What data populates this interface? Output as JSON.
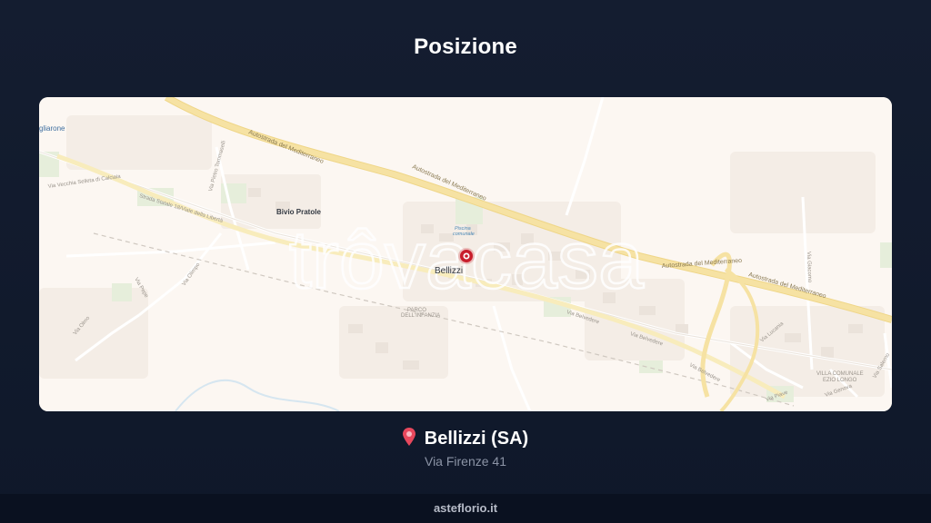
{
  "page": {
    "title": "Posizione"
  },
  "map": {
    "watermark": "trôvacasa",
    "marker_icon": "location-marker",
    "labels": {
      "autostrada_1": "Autostrada del Mediterraneo",
      "autostrada_2": "Autostrada del Mediterraneo",
      "autostrada_3": "Autostrada del Mediterraneo",
      "autostrada_4": "Autostrada del Mediterraneo",
      "town_left": "gliarone",
      "bivio": "Bivio Pratole",
      "bellizzi": "Bellizzi",
      "piscina_1": "Piscina",
      "piscina_2": "comunale",
      "strada_statale": "Strada Statale 18/Viale della Libertà",
      "via_belvedere_1": "Via Belvedere",
      "via_belvedere_2": "Via Belvedere",
      "via_belvedere_3": "Via Belvedere",
      "parco_1": "PARCO",
      "parco_2": "DELL'INFANZIA",
      "villa_1": "VILLA COMUNALE",
      "villa_2": "EZIO LONGO",
      "via_olmo": "Via Olmo",
      "via_olimpo": "Via Olimpo",
      "via_pepe": "Via Pepe",
      "via_tommaselli": "Via Pietro Tommaselli",
      "via_selleta": "Via Vecchia Selleta di Calciaia",
      "via_piave": "Via Piave",
      "via_giacomo": "Via Giacomo",
      "via_genova": "Via Genova",
      "via_lucania": "Via Lucania",
      "via_salerno": "Via Salerno"
    },
    "colors": {
      "background": "#fcf7f2",
      "motorway": "#f6e2a3",
      "marker": "#c81e2c"
    }
  },
  "location": {
    "pin_icon": "map-pin-icon",
    "city": "Bellizzi (SA)",
    "address": "Via Firenze 41"
  },
  "footer": {
    "site": "asteflorio.it"
  }
}
